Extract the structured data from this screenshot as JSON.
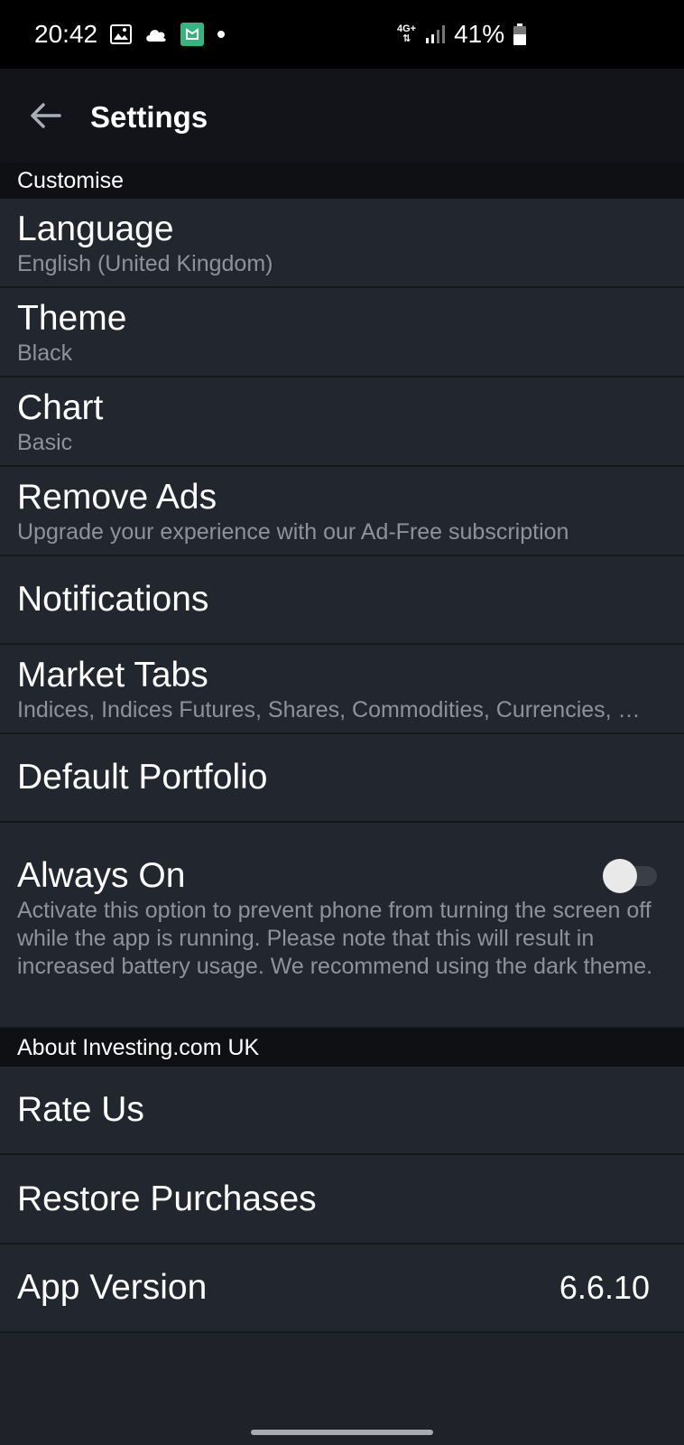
{
  "status": {
    "time": "20:42",
    "network": "4G+",
    "battery": "41%",
    "icons": [
      "image-icon",
      "cloud-icon",
      "app-notification-icon",
      "dot-icon",
      "signal-icon",
      "battery-icon"
    ]
  },
  "appbar": {
    "title": "Settings"
  },
  "sections": {
    "customise": "Customise",
    "about": "About Investing.com UK"
  },
  "settings": {
    "language": {
      "title": "Language",
      "value": "English (United Kingdom)"
    },
    "theme": {
      "title": "Theme",
      "value": "Black"
    },
    "chart": {
      "title": "Chart",
      "value": "Basic"
    },
    "remove_ads": {
      "title": "Remove Ads",
      "value": "Upgrade your experience with our Ad-Free subscription"
    },
    "notifications": {
      "title": "Notifications"
    },
    "market_tabs": {
      "title": "Market Tabs",
      "value": "Indices, Indices Futures, Shares, Commodities, Currencies, C..."
    },
    "default_portfolio": {
      "title": "Default Portfolio"
    },
    "always_on": {
      "title": "Always On",
      "description": "Activate this option to prevent phone from turning the screen off while the app is running. Please note that this will result in increased battery usage. We recommend using the dark theme.",
      "enabled": false
    }
  },
  "about": {
    "rate_us": {
      "title": "Rate Us"
    },
    "restore_purchases": {
      "title": "Restore Purchases"
    },
    "app_version": {
      "title": "App Version",
      "value": "6.6.10"
    }
  },
  "colors": {
    "background": "#1f2229",
    "row": "#22262e",
    "header": "#121419",
    "section": "#0e1014",
    "subtext": "#8e939b"
  }
}
